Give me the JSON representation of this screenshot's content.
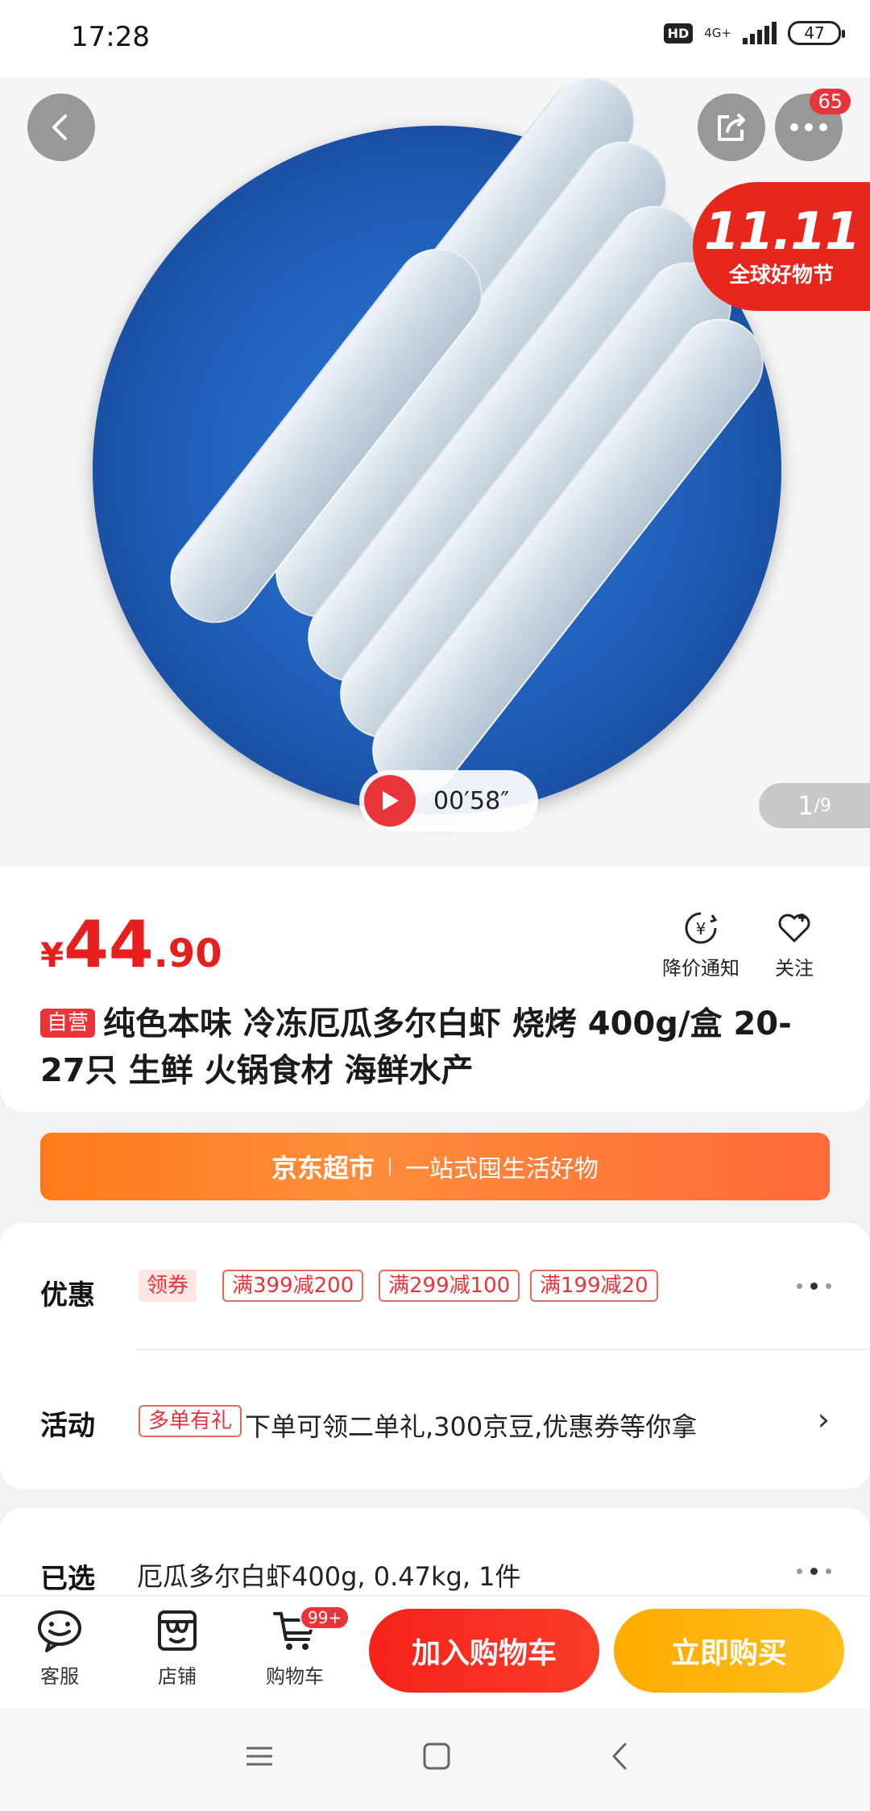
{
  "status_bar": {
    "time": "17:28",
    "hd": "HD",
    "network": "4G+",
    "battery": "47"
  },
  "hero": {
    "more_badge": "65",
    "promo_big": "11.11",
    "promo_small": "全球好物节",
    "video_duration": "00′58″",
    "image_index": "1",
    "image_total": "/9",
    "icons": {
      "back": "chevron-left-icon",
      "share": "share-icon",
      "more": "more-dots-icon",
      "play": "play-icon"
    }
  },
  "product": {
    "currency": "¥",
    "price_int": "44",
    "price_dec": ".90",
    "price_alert_label": "降价通知",
    "follow_label": "关注",
    "self_operated_tag": "自营",
    "title": "纯色本味 冷冻厄瓜多尔白虾 烧烤 400g/盒 20-27只  生鲜  火锅食材 海鲜水产"
  },
  "banner": {
    "brand": "京东超市",
    "slogan": "一站式囤生活好物"
  },
  "offers": {
    "label": "优惠",
    "get_coupon": "领券",
    "coupons": [
      "满399减200",
      "满299减100",
      "满199减20"
    ]
  },
  "activity": {
    "label": "活动",
    "tag": "多单有礼",
    "text": "下单可领二单礼,300京豆,优惠券等你拿"
  },
  "selected": {
    "label": "已选",
    "value": "厄瓜多尔白虾400g, 0.47kg, 1件"
  },
  "action_bar": {
    "service_label": "客服",
    "store_label": "店铺",
    "cart_label": "购物车",
    "cart_badge": "99+",
    "add_to_cart": "加入购物车",
    "buy_now": "立即购买"
  },
  "colors": {
    "price_red": "#e61e1e",
    "promo_red": "#e7261e",
    "banner_orange": "#ff7a1a",
    "buy_yellow": "#ffab00"
  }
}
